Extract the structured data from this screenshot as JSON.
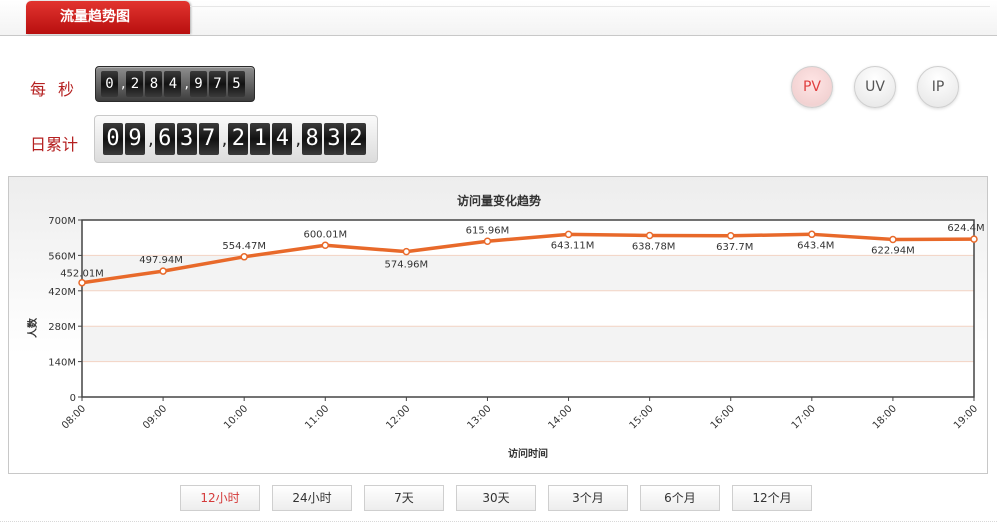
{
  "tab": {
    "active_label": "流量趋势图"
  },
  "counters": {
    "per_second": {
      "label": "每秒",
      "digits": [
        "0",
        "2",
        "8",
        "4",
        "9",
        "7",
        "5"
      ]
    },
    "daily_total": {
      "label": "日累计",
      "digits": [
        "0",
        "9",
        "6",
        "3",
        "7",
        "2",
        "1",
        "4",
        "8",
        "3",
        "2"
      ]
    }
  },
  "metric_buttons": [
    {
      "label": "PV",
      "active": true
    },
    {
      "label": "UV",
      "active": false
    },
    {
      "label": "IP",
      "active": false
    }
  ],
  "range_buttons": [
    {
      "label": "12小时",
      "active": true
    },
    {
      "label": "24小时",
      "active": false
    },
    {
      "label": "7天",
      "active": false
    },
    {
      "label": "30天",
      "active": false
    },
    {
      "label": "3个月",
      "active": false
    },
    {
      "label": "6个月",
      "active": false
    },
    {
      "label": "12个月",
      "active": false
    }
  ],
  "colors": {
    "series": "#e8692a",
    "accent": "#c01212"
  },
  "chart_data": {
    "type": "line",
    "title": "访问量变化趋势",
    "xlabel": "访问时间",
    "ylabel": "人数",
    "categories": [
      "08:00",
      "09:00",
      "10:00",
      "11:00",
      "12:00",
      "13:00",
      "14:00",
      "15:00",
      "16:00",
      "17:00",
      "18:00",
      "19:00"
    ],
    "series": [
      {
        "values": [
          452.01,
          497.94,
          554.47,
          600.01,
          574.96,
          615.96,
          643.11,
          638.78,
          637.7,
          643.4,
          622.94,
          624.4
        ],
        "labels": [
          "452.01M",
          "497.94M",
          "554.47M",
          "600.01M",
          "574.96M",
          "615.96M",
          "643.11M",
          "638.78M",
          "637.7M",
          "643.4M",
          "622.94M",
          "624.4M"
        ]
      }
    ],
    "yticks": [
      "0",
      "140M",
      "280M",
      "420M",
      "560M",
      "700M"
    ],
    "ylim": [
      0,
      700
    ],
    "grid": true,
    "legend": "none"
  }
}
